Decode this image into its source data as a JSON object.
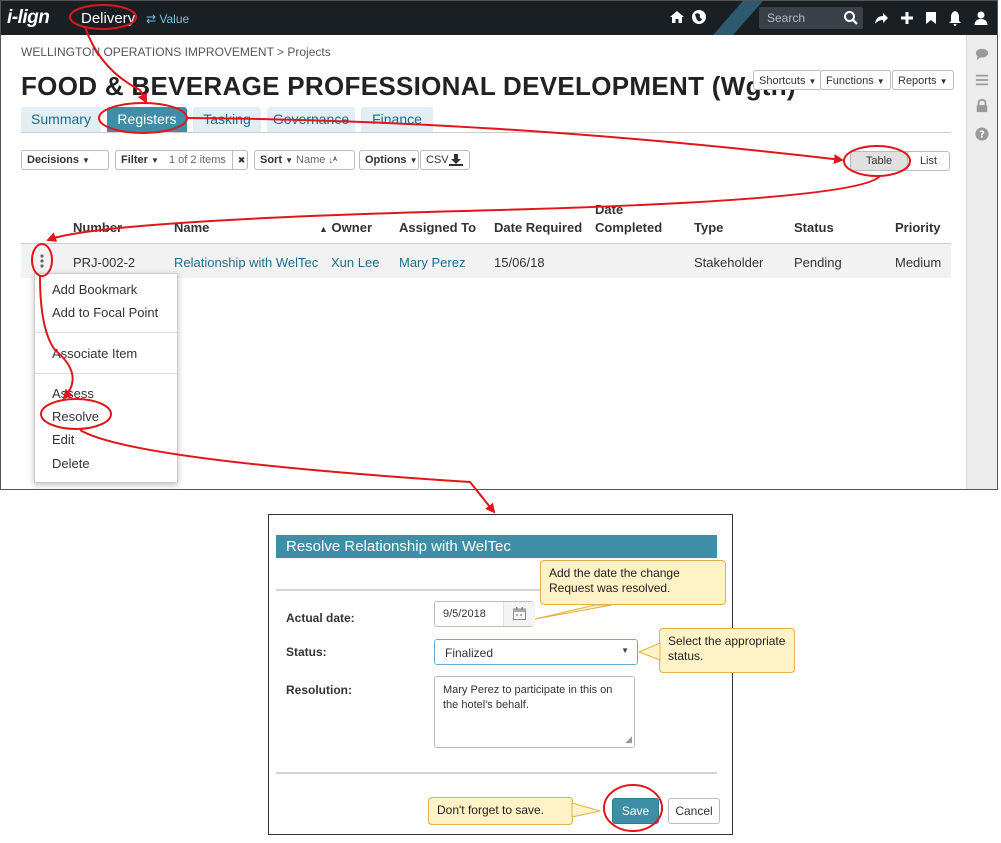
{
  "app": {
    "logo": "i-lign",
    "brand": "Delivery",
    "value_link": "⇄ Value",
    "search_placeholder": "Search"
  },
  "breadcrumb": "WELLINGTON OPERATIONS IMPROVEMENT > Projects",
  "page_title": "FOOD & BEVERAGE PROFESSIONAL DEVELOPMENT (Wgtn)",
  "header_buttons": {
    "shortcuts": "Shortcuts",
    "functions": "Functions",
    "reports": "Reports"
  },
  "tabs": [
    {
      "label": "Summary"
    },
    {
      "label": "Registers"
    },
    {
      "label": "Tasking"
    },
    {
      "label": "Governance"
    },
    {
      "label": "Finance"
    }
  ],
  "toolbar": {
    "decisions": "Decisions",
    "filter": "Filter",
    "filter_count": "1 of 2 items",
    "clear": "✖",
    "sort": "Sort",
    "sort_field": "Name",
    "options": "Options",
    "csv": "CSV",
    "table": "Table",
    "list": "List"
  },
  "table": {
    "headers": {
      "number": "Number",
      "name": "Name",
      "owner": "Owner",
      "assigned": "Assigned To",
      "date_required": "Date Required",
      "date_completed_1": "Date",
      "date_completed_2": "Completed",
      "type": "Type",
      "status": "Status",
      "priority": "Priority"
    },
    "row": {
      "number": "PRJ-002-2",
      "name": "Relationship with WelTec",
      "owner": "Xun Lee",
      "assigned": "Mary Perez",
      "date_required": "15/06/18",
      "date_completed": "",
      "type": "Stakeholder",
      "status": "Pending",
      "priority": "Medium"
    }
  },
  "context_menu": {
    "add_bookmark": "Add Bookmark",
    "add_focal": "Add to Focal Point",
    "associate": "Associate Item",
    "assess": "Assess",
    "resolve": "Resolve",
    "edit": "Edit",
    "delete": "Delete"
  },
  "dialog": {
    "title": "Resolve Relationship with WelTec",
    "actual_date_label": "Actual date:",
    "actual_date_value": "9/5/2018",
    "status_label": "Status:",
    "status_value": "Finalized",
    "resolution_label": "Resolution:",
    "resolution_value": "Mary Perez to participate in this on the hotel's behalf.",
    "save": "Save",
    "cancel": "Cancel"
  },
  "callouts": {
    "date": "Add the date the change Request was resolved.",
    "status": "Select the appropriate status.",
    "save": "Don't forget to save."
  },
  "colors": {
    "topbar": "#1a1f24",
    "accent": "#3e8ea8",
    "link": "#1d6e8d",
    "annotation": "#e0161b",
    "callout_bg": "#fff2c6"
  }
}
